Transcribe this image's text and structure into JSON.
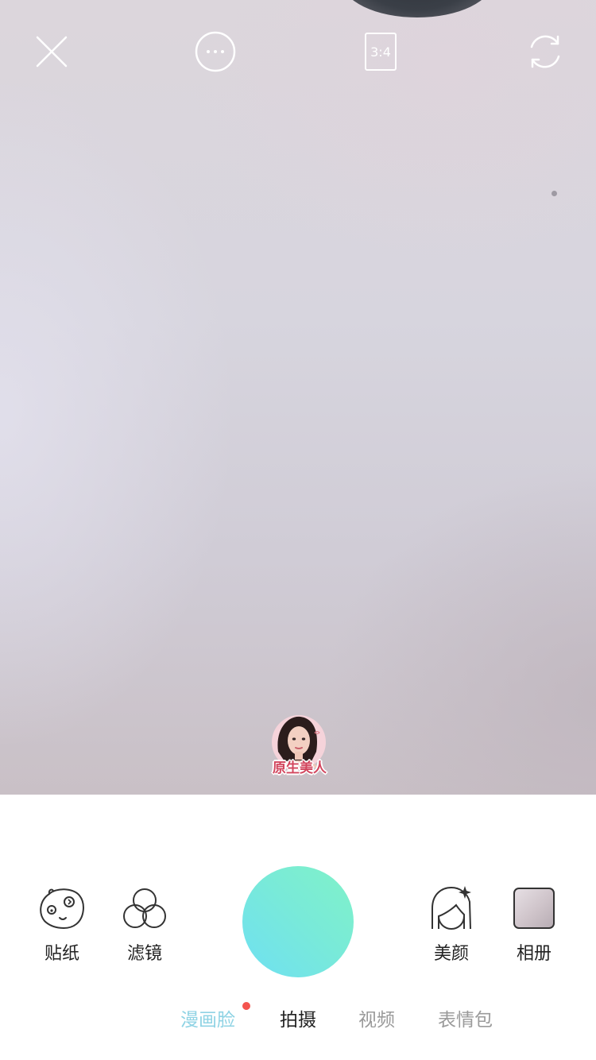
{
  "camera": {
    "ratio_label": "3:4",
    "badge_text": "原生美人"
  },
  "toolbar": {
    "sticker_label": "贴纸",
    "filter_label": "滤镜",
    "beauty_label": "美颜",
    "album_label": "相册"
  },
  "modes": [
    {
      "label": "漫画脸",
      "state": "highlighted",
      "has_dot": true
    },
    {
      "label": "拍摄",
      "state": "selected"
    },
    {
      "label": "视频",
      "state": "normal"
    },
    {
      "label": "表情包",
      "state": "normal"
    }
  ],
  "colors": {
    "shutter_gradient_start": "#80f2c8",
    "shutter_gradient_end": "#6fe0f2",
    "manga_accent": "#8fd3e4",
    "notification_dot": "#f4544f",
    "badge_text": "#d2465e"
  },
  "icons": [
    "close-icon",
    "more-icon",
    "aspect-ratio-icon",
    "flip-camera-icon",
    "sticker-icon",
    "filter-icon",
    "beauty-icon",
    "album-thumbnail"
  ]
}
